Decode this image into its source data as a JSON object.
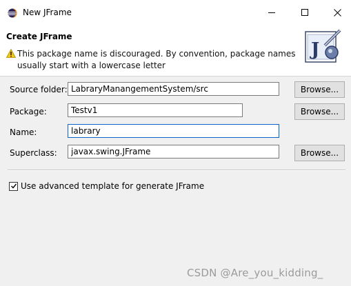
{
  "window": {
    "title": "New JFrame",
    "icon": "eclipse-icon"
  },
  "header": {
    "title": "Create JFrame",
    "warning_icon": "warning-icon",
    "warning_text": "This package name is discouraged. By convention, package names usually start with a lowercase letter",
    "banner_icon": "jframe-wizard-icon"
  },
  "form": {
    "source_folder": {
      "label": "Source folder:",
      "value": "LabraryManangementSystem/src",
      "button": "Browse..."
    },
    "package": {
      "label": "Package:",
      "value": "Testv1",
      "button": "Browse..."
    },
    "name": {
      "label": "Name:",
      "value": "labrary"
    },
    "superclass": {
      "label": "Superclass:",
      "value": "javax.swing.JFrame",
      "button": "Browse..."
    }
  },
  "options": {
    "advanced_template": {
      "label": "Use advanced template for generate JFrame",
      "checked": true
    }
  },
  "watermark": "CSDN @Are_you_kidding_",
  "colors": {
    "accent": "#0a63c9",
    "warning": "#f2c811"
  }
}
